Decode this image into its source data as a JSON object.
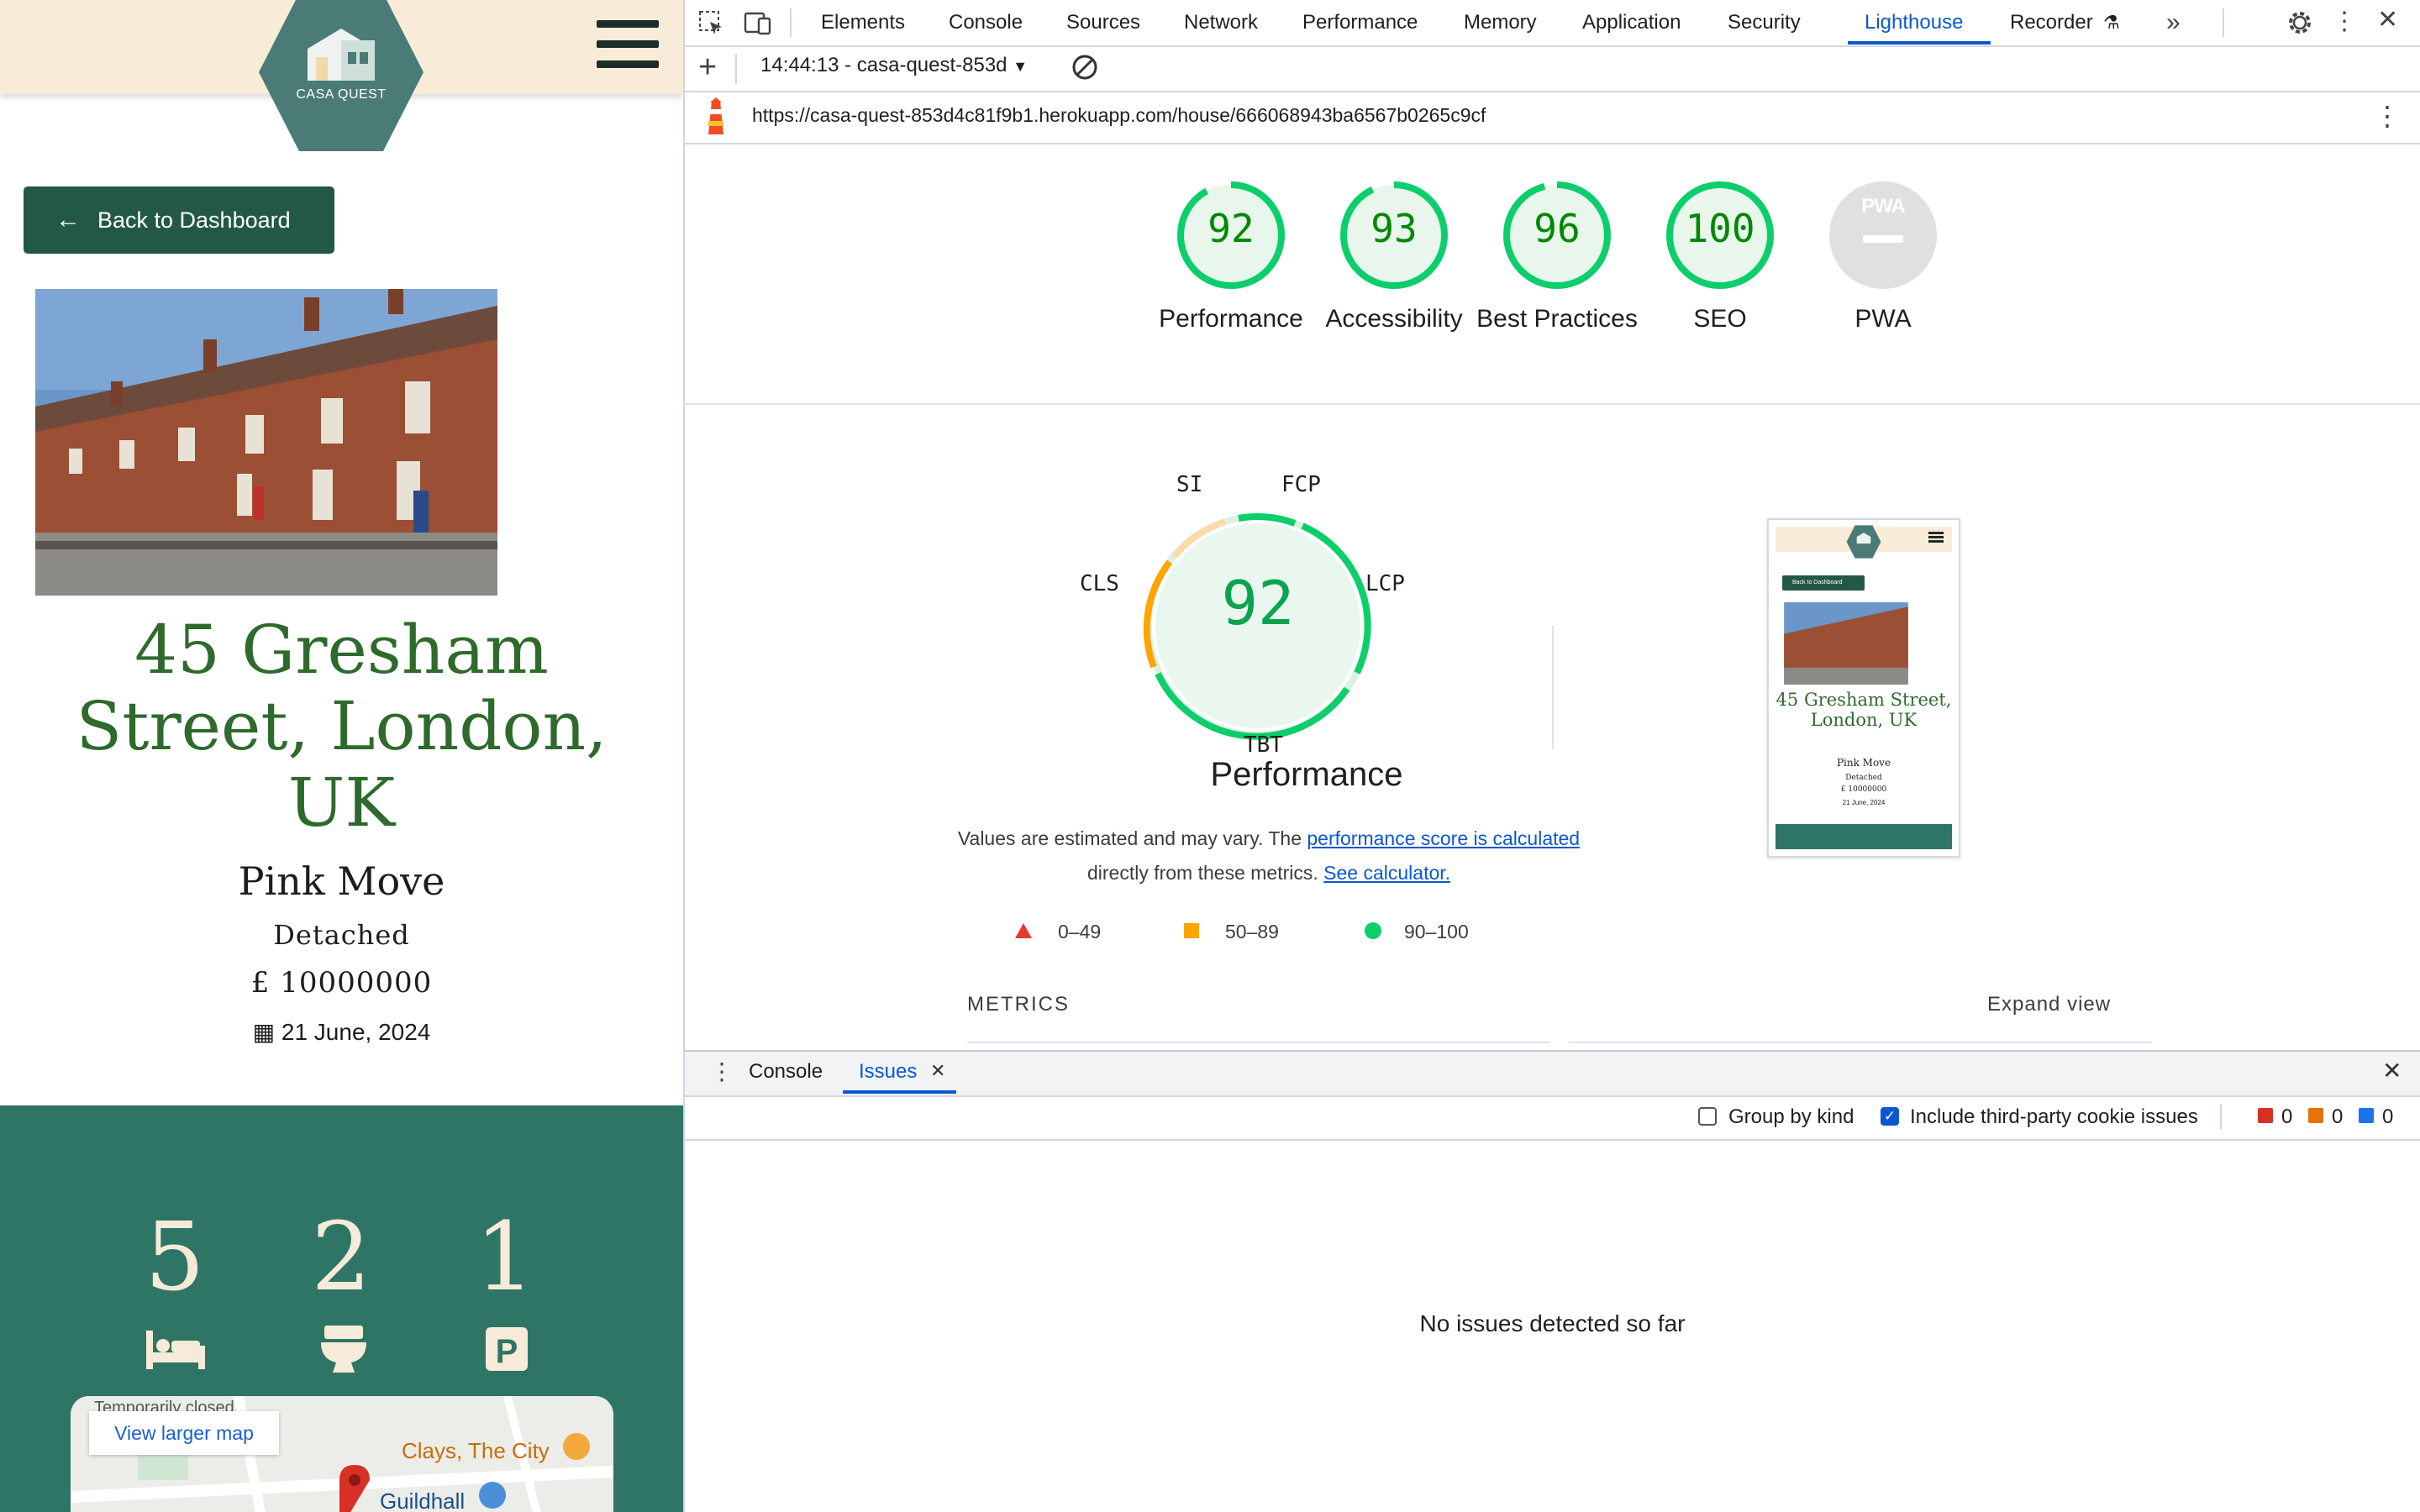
{
  "app": {
    "logo_text": "CASA QUEST",
    "back_label": "Back to Dashboard",
    "title": "45 Gresham Street, London, UK",
    "agent": "Pink Move",
    "property_type": "Detached",
    "price": "£ 10000000",
    "date": "21 June, 2024",
    "features": {
      "bedrooms": "5",
      "bathrooms": "2",
      "parking": "1"
    },
    "map": {
      "closed_text": "Temporarily closed",
      "view_larger": "View larger map",
      "place1": "Clays, The City",
      "place2": "Guildhall"
    },
    "colors": {
      "header_bg": "#f8ecd9",
      "brand_green": "#235849",
      "features_bg": "#2e7565",
      "title_green": "#2e6a2c"
    }
  },
  "devtools": {
    "tabs": [
      "Elements",
      "Console",
      "Sources",
      "Network",
      "Performance",
      "Memory",
      "Application",
      "Security",
      "Lighthouse",
      "Recorder"
    ],
    "active_tab": "Lighthouse",
    "report_label": "14:44:13 - casa-quest-853d",
    "url": "https://casa-quest-853d4c81f9b1.herokuapp.com/house/666068943ba6567b0265c9cf",
    "scores": [
      {
        "label": "Performance",
        "value": "92"
      },
      {
        "label": "Accessibility",
        "value": "93"
      },
      {
        "label": "Best Practices",
        "value": "96"
      },
      {
        "label": "SEO",
        "value": "100"
      },
      {
        "label": "PWA",
        "value": "PWA"
      }
    ],
    "performance": {
      "score": "92",
      "title": "Performance",
      "metrics": [
        "SI",
        "FCP",
        "LCP",
        "TBT",
        "CLS"
      ],
      "note_text1": "Values are estimated and may vary. The ",
      "note_link1": "performance score is calculated",
      "note_text2": " directly from these metrics. ",
      "note_link2": "See calculator.",
      "legend": [
        "0–49",
        "50–89",
        "90–100"
      ],
      "metrics_heading": "METRICS",
      "expand_view": "Expand view"
    },
    "thumb": {
      "back": "Back to Dashboard",
      "title": "45 Gresham Street, London, UK",
      "agent": "Pink Move",
      "type": "Detached",
      "price": "£ 10000000",
      "date": "21 June, 2024"
    },
    "drawer": {
      "tabs": [
        "Console",
        "Issues"
      ],
      "group_by_kind": "Group by kind",
      "third_party": "Include third-party cookie issues",
      "counts": [
        "0",
        "0",
        "0"
      ],
      "no_issues": "No issues detected so far"
    },
    "colors": {
      "pass": "#0cce6b",
      "average": "#ffa400",
      "fail": "#ff4e42",
      "accent": "#0b57d0"
    }
  }
}
